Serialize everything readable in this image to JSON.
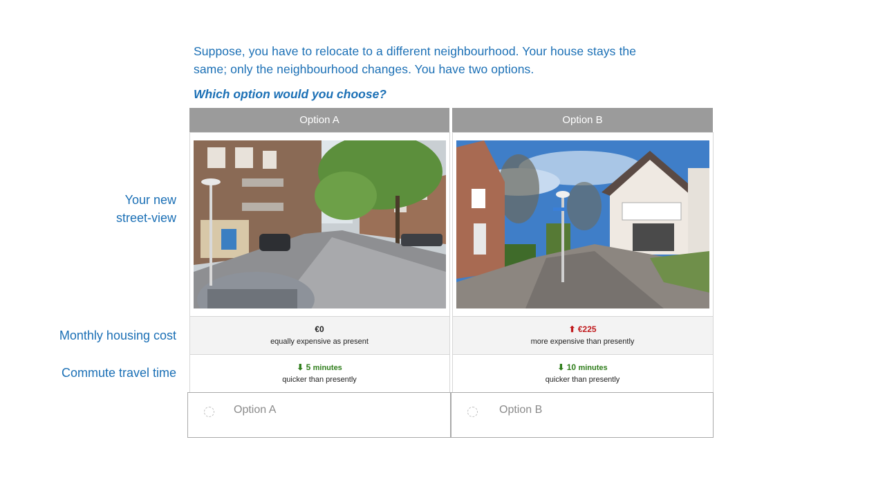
{
  "intro": {
    "line1": "Suppose, you have to relocate to a different neighbourhood. Your house stays the",
    "line2": "same; only the neighbourhood changes. You have two options.",
    "question": "Which option would you choose?"
  },
  "row_labels": {
    "street_view_1": "Your new",
    "street_view_2": "street-view",
    "housing_cost": "Monthly housing cost",
    "commute": "Commute travel time"
  },
  "options": [
    {
      "header": "Option A",
      "cost_value": "€0",
      "cost_arrow": "",
      "cost_desc": "equally expensive as present",
      "commute_arrow": "⬇",
      "commute_value": "5",
      "commute_unit": "minutes",
      "commute_desc": "quicker than presently",
      "choice_label": "Option A"
    },
    {
      "header": "Option B",
      "cost_value": "€225",
      "cost_arrow": "⬆",
      "cost_desc": "more expensive than presently",
      "commute_arrow": "⬇",
      "commute_value": "10",
      "commute_unit": "minutes",
      "commute_desc": "quicker than presently",
      "choice_label": "Option B"
    }
  ],
  "colors": {
    "accent_blue": "#1a6fb5",
    "header_grey": "#9b9b9b",
    "increase_red": "#c0191c",
    "decrease_green": "#2e7d1a"
  }
}
